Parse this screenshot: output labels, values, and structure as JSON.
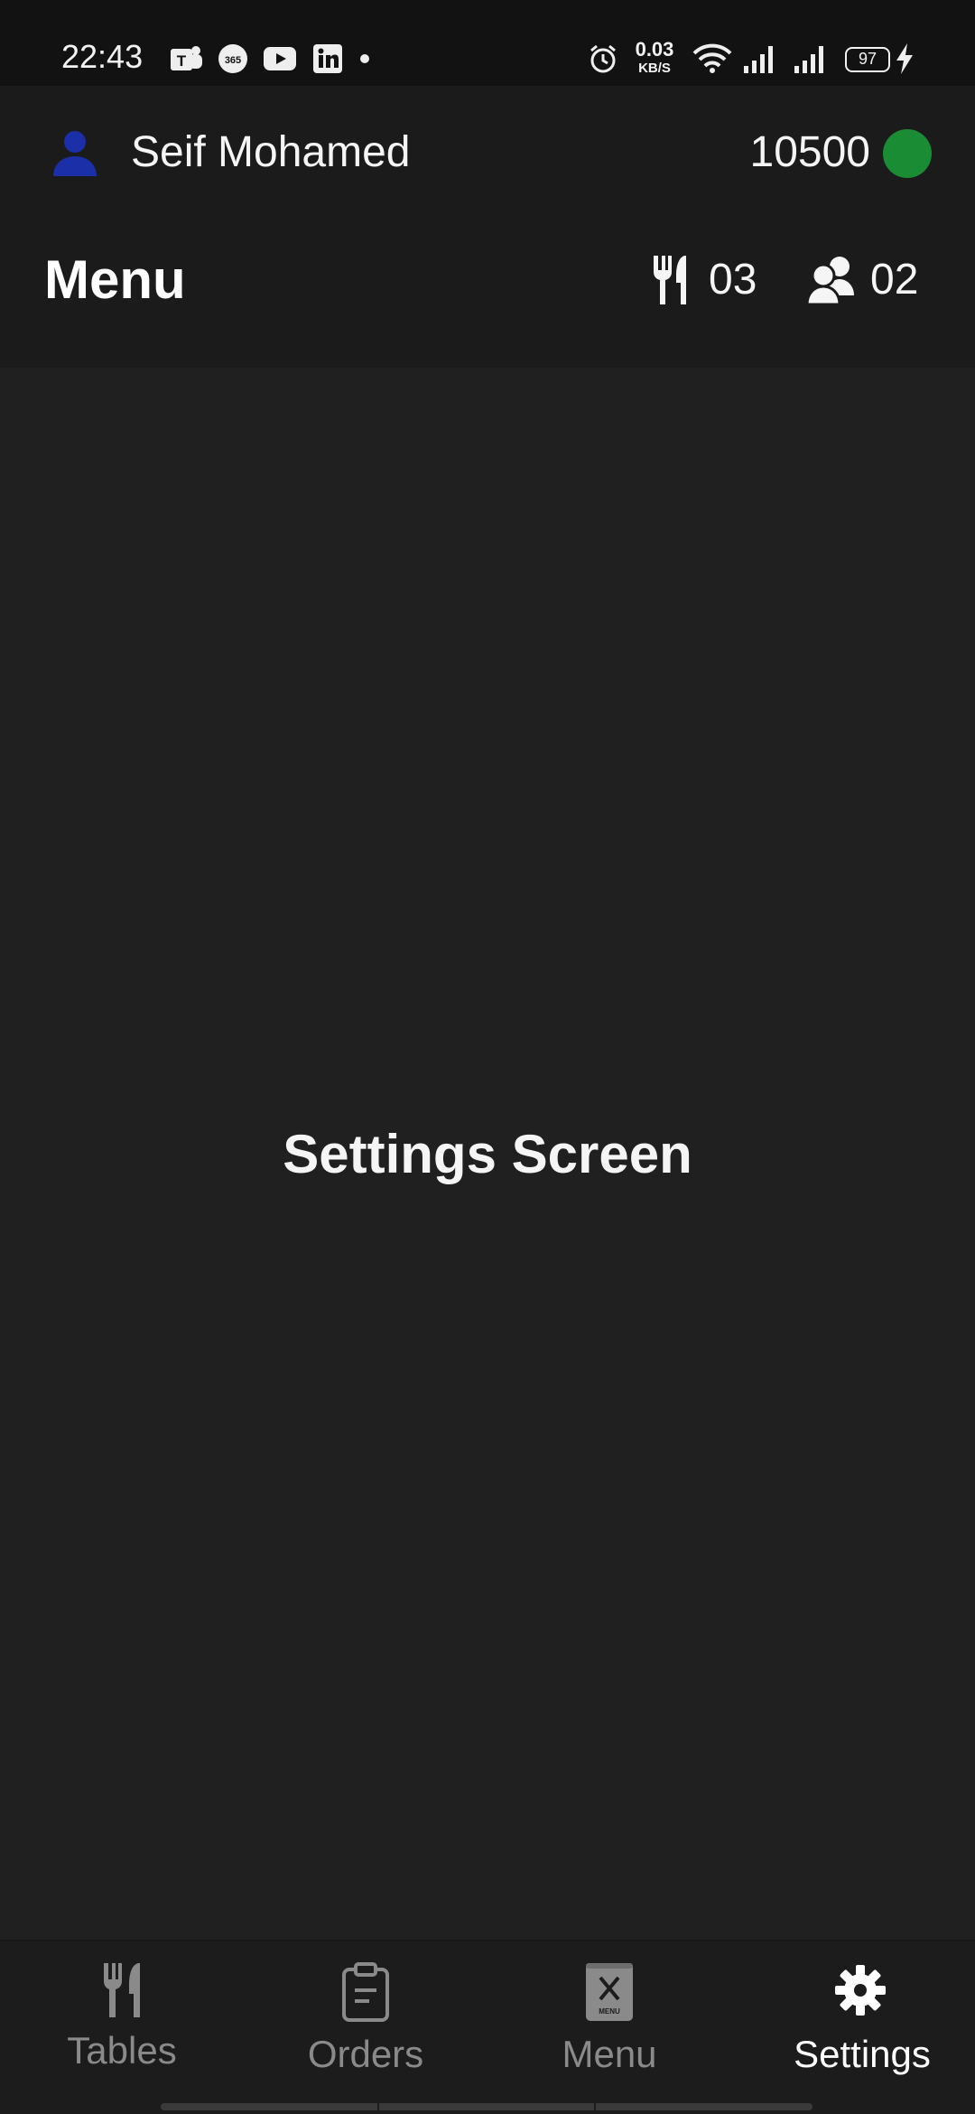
{
  "status_bar": {
    "time": "22:43",
    "net_speed_value": "0.03",
    "net_speed_unit": "KB/S",
    "battery_level": "97",
    "notification_icons": [
      "teams-icon",
      "office365-icon",
      "youtube-icon",
      "linkedin-icon",
      "more-dot-icon"
    ],
    "system_icons": [
      "alarm-icon",
      "wifi-icon",
      "signal-icon",
      "signal-icon",
      "battery-icon",
      "charging-icon"
    ]
  },
  "header": {
    "user_name": "Seif Mohamed",
    "coins": "10500",
    "status_color": "#1a8c33",
    "avatar_color": "#1a2fa8",
    "page_title": "Menu",
    "tables_count": "03",
    "guests_count": "02"
  },
  "main": {
    "title": "Settings Screen"
  },
  "bottom_nav": {
    "items": [
      {
        "label": "Tables",
        "icon": "utensils-icon",
        "active": false
      },
      {
        "label": "Orders",
        "icon": "clipboard-icon",
        "active": false
      },
      {
        "label": "Menu",
        "icon": "menu-book-icon",
        "active": false
      },
      {
        "label": "Settings",
        "icon": "gear-icon",
        "active": true
      }
    ]
  }
}
